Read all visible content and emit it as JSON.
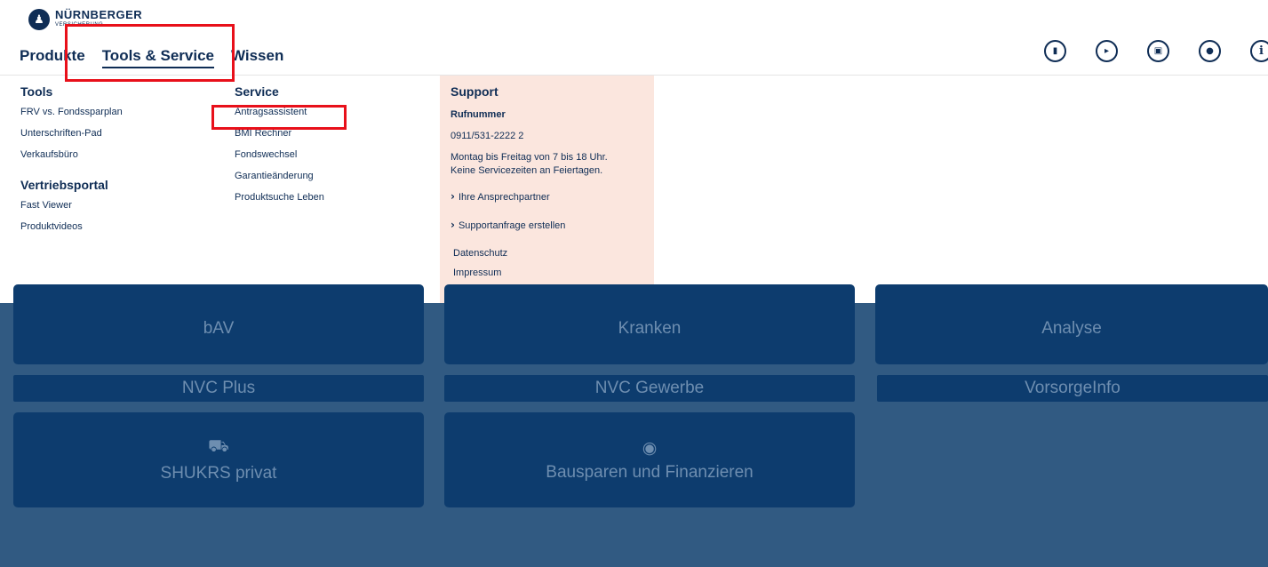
{
  "brand": {
    "icon": "family-logo-icon",
    "name": "NÜRNBERGER",
    "sub": "VERSICHERUNG"
  },
  "nav": {
    "items": [
      {
        "label": "Produkte"
      },
      {
        "label": "Tools & Service"
      },
      {
        "label": "Wissen"
      }
    ],
    "active": "Tools & Service"
  },
  "toolbar_icons": [
    "document-icon",
    "folder-open-icon",
    "save-icon",
    "user-icon",
    "info-icon"
  ],
  "menu": {
    "tools": {
      "heading": "Tools",
      "links": [
        "FRV vs. Fondssparplan",
        "Unterschriften-Pad",
        "Verkaufsbüro"
      ]
    },
    "vertriebsportal": {
      "heading": "Vertriebsportal",
      "links": [
        "Fast Viewer",
        "Produktvideos"
      ]
    },
    "service": {
      "heading": "Service",
      "links": [
        "Antragsassistent",
        "BMI Rechner",
        "Fondswechsel",
        "Garantieänderung",
        "Produktsuche Leben"
      ]
    },
    "support": {
      "heading": "Support",
      "phone_label": "Rufnummer",
      "phone": "0911/531-2222 2",
      "hours_line1": "Montag bis Freitag von 7 bis 18 Uhr.",
      "hours_line2": "Keine Servicezeiten an Feiertagen.",
      "link1": "Ihre Ansprechpartner",
      "link2": "Supportanfrage erstellen",
      "privacy": "Datenschutz",
      "imprint": "Impressum"
    }
  },
  "tiles": {
    "bav": "bAV",
    "kranken": "Kranken",
    "analyse": "Analyse",
    "nvc_plus": "NVC Plus",
    "nvc_gewerbe": "NVC Gewerbe",
    "vorsorgeinfo": "VorsorgeInfo",
    "shukrs": "SHUKRS privat",
    "bausparen": "Bausparen und Finanzieren"
  },
  "colors": {
    "brand": "#0f2d55",
    "highlight": "#e8101a",
    "support_bg": "#fbe6de",
    "tile": "#0d3c6e",
    "backdrop": "#315a82"
  }
}
